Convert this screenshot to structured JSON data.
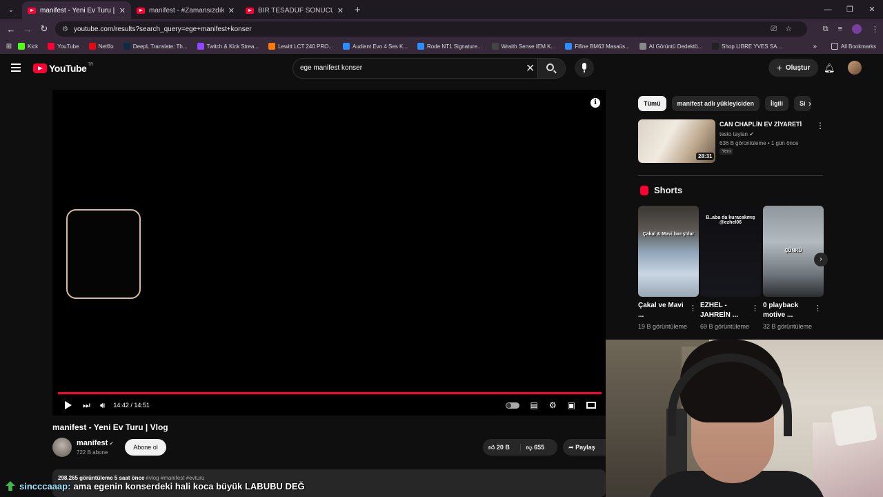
{
  "browser": {
    "tabs": [
      {
        "title": "manifest - Yeni Ev Turu | Vlog",
        "active": true
      },
      {
        "title": "manifest - #ZamansızdıkChalle",
        "active": false
      },
      {
        "title": "BİR TESADÜF SONUCU ÇÖZÜL",
        "active": false
      }
    ],
    "url": "youtube.com/results?search_query=ege+manifest+konser",
    "bookmarks": [
      {
        "label": "Kick",
        "color": "#53fc18"
      },
      {
        "label": "YouTube",
        "color": "#ff0033"
      },
      {
        "label": "Netflix",
        "color": "#e50914"
      },
      {
        "label": "DeepL Translate: Th...",
        "color": "#0f2b46"
      },
      {
        "label": "Twitch & Kick Strea...",
        "color": "#9146ff"
      },
      {
        "label": "Lewitt LCT 240 PRO...",
        "color": "#ff7a00"
      },
      {
        "label": "Audient Evo 4 Ses K...",
        "color": "#2d8cff"
      },
      {
        "label": "Rode NT1 Signature...",
        "color": "#2d8cff"
      },
      {
        "label": "Wraith Sense IEM K...",
        "color": "#444444"
      },
      {
        "label": "Fifine BM63 Masaüs...",
        "color": "#2d8cff"
      },
      {
        "label": "AI Görüntü Dedektö...",
        "color": "#888888"
      },
      {
        "label": "Shop LIBRE YVES SA...",
        "color": "#222222"
      }
    ],
    "all_bookmarks": "All Bookmarks"
  },
  "youtube": {
    "logo_text": "YouTube",
    "country": "TR",
    "search_value": "ege manifest konser",
    "create_label": "Oluştur",
    "player": {
      "time": "14:42 / 14:51",
      "progress": 0.99
    },
    "video": {
      "title": "manifest - Yeni Ev Turu | Vlog",
      "channel": "manifest",
      "subscribers": "722 B abone",
      "subscribe_label": "Abone ol",
      "likes": "20 B",
      "dislikes": "655",
      "share_label": "Paylaş",
      "views_date": "298.265 görüntüleme  5 saat önce",
      "tags": "#vlog #manifest #evturu"
    },
    "chips": [
      "Tümü",
      "manifest adlı yükleyiciden",
      "İlgili",
      "Si"
    ],
    "recommendation": {
      "title": "CAN CHAPLİN EV ZİYARETİ",
      "channel": "testo taylan",
      "meta": "636 B görüntüleme • 1 gün önce",
      "badge": "Yeni",
      "duration": "28:31"
    },
    "shorts_heading": "Shorts",
    "shorts": [
      {
        "title": "Çakal ve Mavi ...",
        "views": "19 B görüntüleme",
        "caption": "Çakal & Mavi barıştılar"
      },
      {
        "title": "EZHEL - JAHREİN ...",
        "views": "69 B görüntüleme",
        "caption": "B..aba da kuracakmış @ezhel06"
      },
      {
        "title": "0 playback motive ...",
        "views": "32 B görüntüleme",
        "caption": "ÇÜNKÜ"
      }
    ]
  },
  "chat": {
    "user": "sincccaaap:",
    "message": "ama egenin konserdeki hali koca büyük LABUBU DEĞ"
  }
}
